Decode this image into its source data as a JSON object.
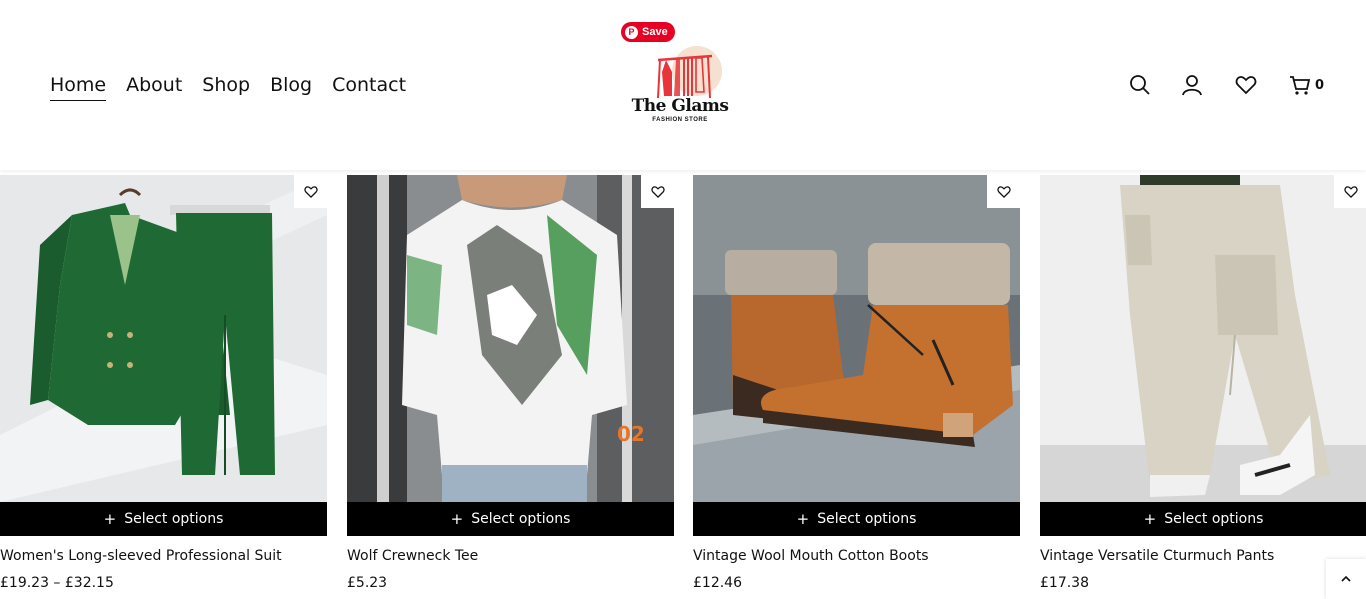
{
  "nav": {
    "items": [
      {
        "label": "Home",
        "active": true
      },
      {
        "label": "About"
      },
      {
        "label": "Shop"
      },
      {
        "label": "Blog"
      },
      {
        "label": "Contact"
      }
    ]
  },
  "pinterest": {
    "label": "Save"
  },
  "logo": {
    "title": "The Glams",
    "subtitle": "FASHION STORE"
  },
  "header_icons": {
    "search": "search-icon",
    "account": "user-icon",
    "wishlist": "heart-icon",
    "cart": "cart-icon",
    "cart_count": "0"
  },
  "products": [
    {
      "name": "Women's Long-sleeved Professional Suit",
      "price": "£19.23 – £32.15",
      "button": "Select options"
    },
    {
      "name": "Wolf Crewneck Tee",
      "price": "£5.23",
      "button": "Select options"
    },
    {
      "name": "Vintage Wool Mouth Cotton Boots",
      "price": "£12.46",
      "button": "Select options"
    },
    {
      "name": "Vintage Versatile Cturmuch Pants",
      "price": "£17.38",
      "button": "Select options"
    }
  ],
  "product_image_text": {
    "tee_number": "02"
  },
  "colors": {
    "accent": "#000000",
    "pinterest": "#e60023",
    "logo_red": "#e8343b"
  }
}
